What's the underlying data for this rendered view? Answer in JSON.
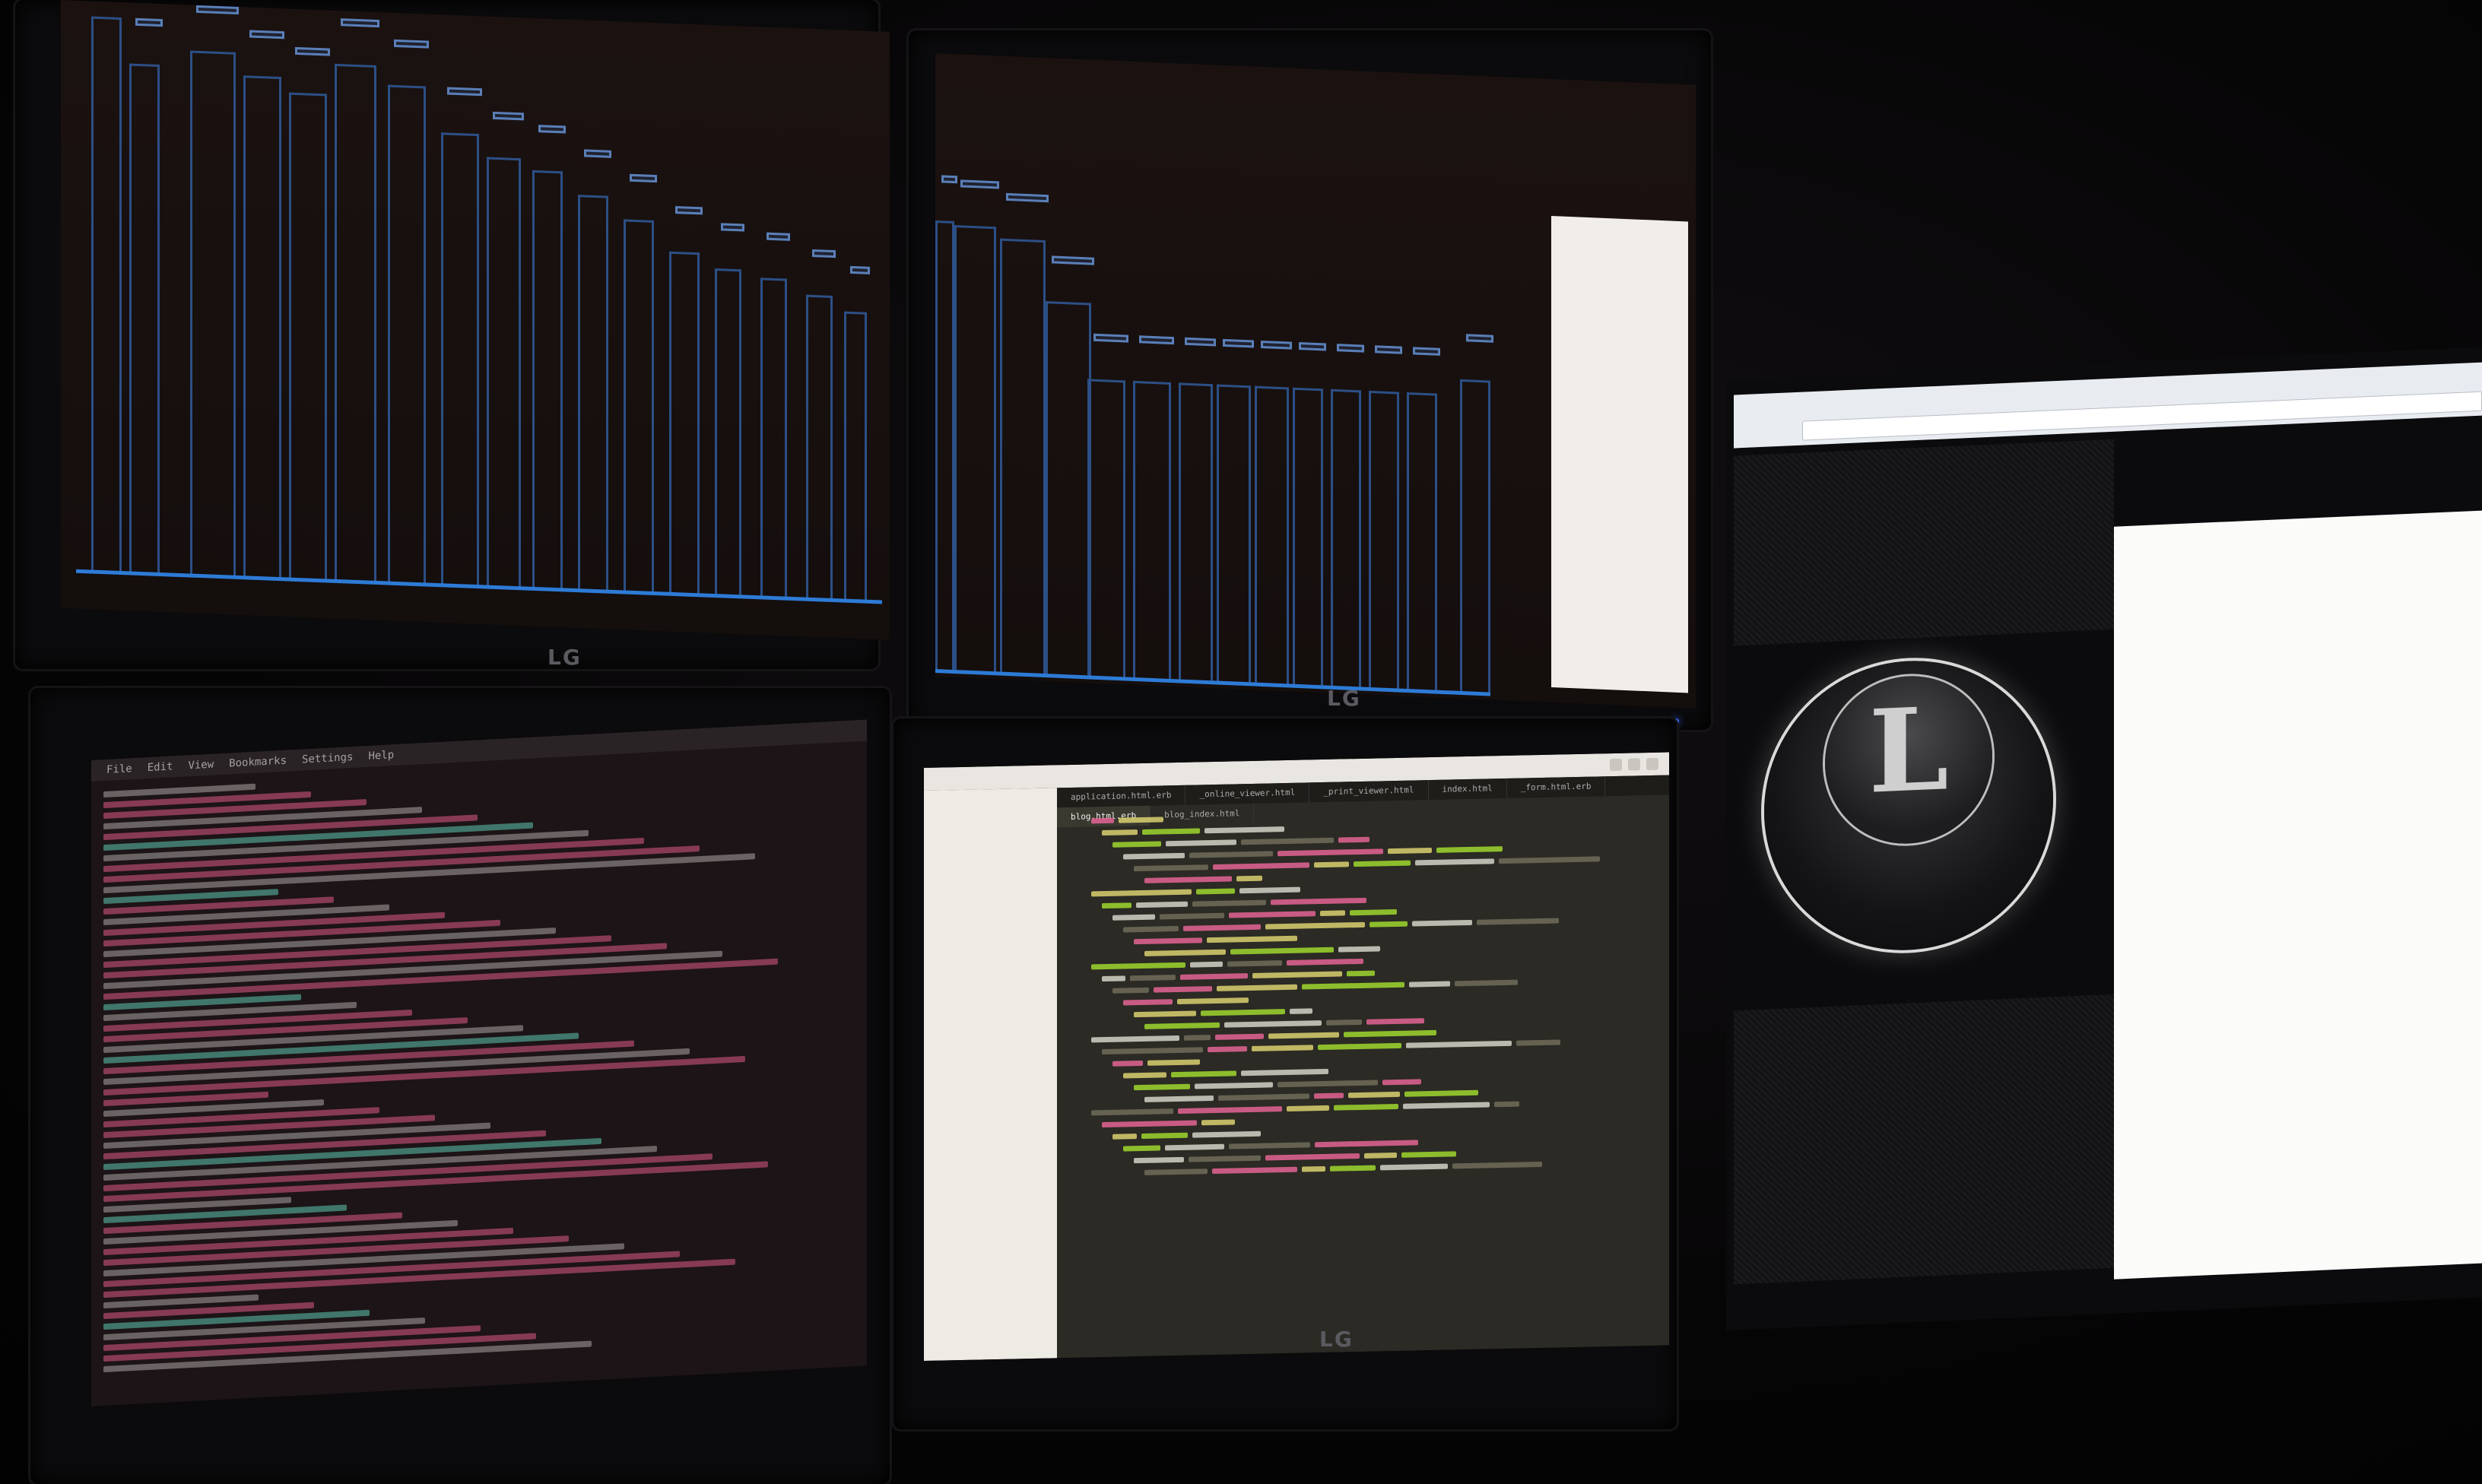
{
  "monitors": {
    "top_left": {
      "brand": "LG"
    },
    "top_center": {
      "brand": "LG"
    },
    "bottom_center": {
      "brand": "LG"
    }
  },
  "terminal": {
    "menu": [
      "File",
      "Edit",
      "View",
      "Bookmarks",
      "Settings",
      "Help"
    ]
  },
  "editor": {
    "tabs": [
      "application.html.erb",
      "_online_viewer.html",
      "_print_viewer.html",
      "index.html",
      "_form.html.erb",
      "blog.html.erb",
      "blog_index.html"
    ]
  },
  "browser": {
    "logo_letter": "L"
  },
  "colors": {
    "chart_bar": "#2c4f86",
    "chart_baseline": "#2d7bd6",
    "terminal_pink": "#e05a8a",
    "editor_bg": "#2b2a24",
    "clock": "#2b5cff"
  }
}
